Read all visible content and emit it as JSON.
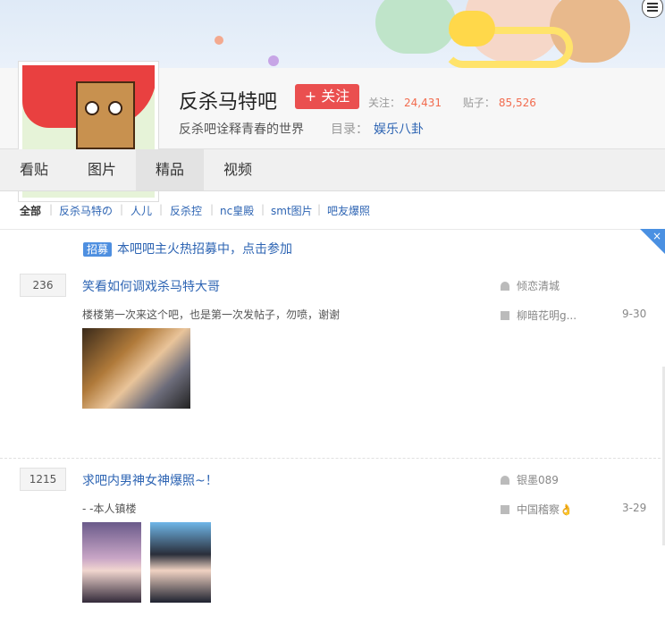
{
  "forum": {
    "name": "反杀马特吧",
    "follow_label": "关注",
    "follow_plus": "+",
    "followers_label": "关注：",
    "followers_count": "24,431",
    "posts_label": "贴子：",
    "posts_count": "85,526",
    "slogan": "反杀吧诠释青春的世界",
    "catalog_label": "目录：",
    "catalog_value": "娱乐八卦"
  },
  "tabs": [
    {
      "label": "看贴"
    },
    {
      "label": "图片"
    },
    {
      "label": "精品",
      "active": true
    },
    {
      "label": "视频"
    }
  ],
  "filters": [
    "全部",
    "反杀马特の",
    "人儿",
    "反杀控",
    "nc皇殿",
    "smt图片",
    "吧友爆照"
  ],
  "filter_sep": "|",
  "notice": {
    "tag": "招募",
    "text": "本吧吧主火热招募中，点击参加",
    "close": "×"
  },
  "threads": [
    {
      "reply_count": "236",
      "title": "笑看如何调戏杀马特大哥",
      "abstract": "楼楼第一次来这个吧，也是第一次发帖子，勿喷，谢谢",
      "author": "倾恋清城",
      "last_reply": "柳暗花明g...",
      "date": "9-30"
    },
    {
      "reply_count": "1215",
      "title": "求吧内男神女神爆照~！",
      "abstract": "- -本人镇楼",
      "author": "银墨089",
      "last_reply": "中国稽察👌",
      "date": "3-29"
    }
  ],
  "icons": {
    "menu": "menu-icon",
    "author": "user-icon",
    "last_reply": "comment-icon"
  },
  "colors": {
    "accent": "#2d64b3",
    "follow": "#ea4f4f",
    "count": "#f26c4f"
  }
}
